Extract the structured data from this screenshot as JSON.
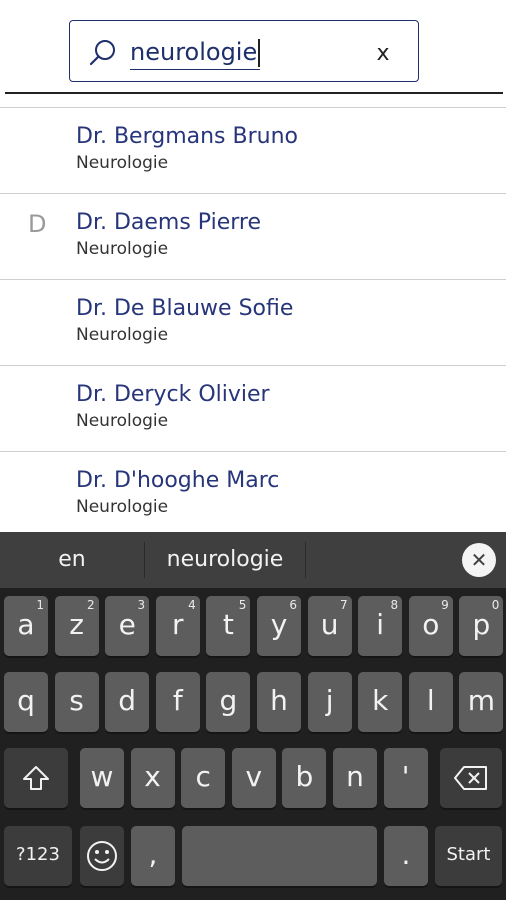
{
  "search": {
    "query": "neurologie",
    "clear_label": "x"
  },
  "results": [
    {
      "index": "",
      "name": "Dr. Bergmans Bruno",
      "specialty": "Neurologie"
    },
    {
      "index": "D",
      "name": "Dr. Daems Pierre",
      "specialty": "Neurologie"
    },
    {
      "index": "",
      "name": "Dr. De Blauwe Sofie",
      "specialty": "Neurologie"
    },
    {
      "index": "",
      "name": "Dr. Deryck Olivier",
      "specialty": "Neurologie"
    },
    {
      "index": "",
      "name": "Dr. D'hooghe Marc",
      "specialty": "Neurologie"
    }
  ],
  "keyboard": {
    "suggestions": [
      "en",
      "neurologie"
    ],
    "row1": [
      {
        "label": "a",
        "sup": "1"
      },
      {
        "label": "z",
        "sup": "2"
      },
      {
        "label": "e",
        "sup": "3"
      },
      {
        "label": "r",
        "sup": "4"
      },
      {
        "label": "t",
        "sup": "5"
      },
      {
        "label": "y",
        "sup": "6"
      },
      {
        "label": "u",
        "sup": "7"
      },
      {
        "label": "i",
        "sup": "8"
      },
      {
        "label": "o",
        "sup": "9"
      },
      {
        "label": "p",
        "sup": "0"
      }
    ],
    "row2": [
      "q",
      "s",
      "d",
      "f",
      "g",
      "h",
      "j",
      "k",
      "l",
      "m"
    ],
    "row3": [
      "w",
      "x",
      "c",
      "v",
      "b",
      "n",
      "'"
    ],
    "symbols_label": "?123",
    "comma_label": ",",
    "period_label": ".",
    "enter_label": "Start"
  },
  "colors": {
    "accent": "#27357a",
    "keyboard_bg": "#202020",
    "key_bg": "#5d5d5d"
  }
}
